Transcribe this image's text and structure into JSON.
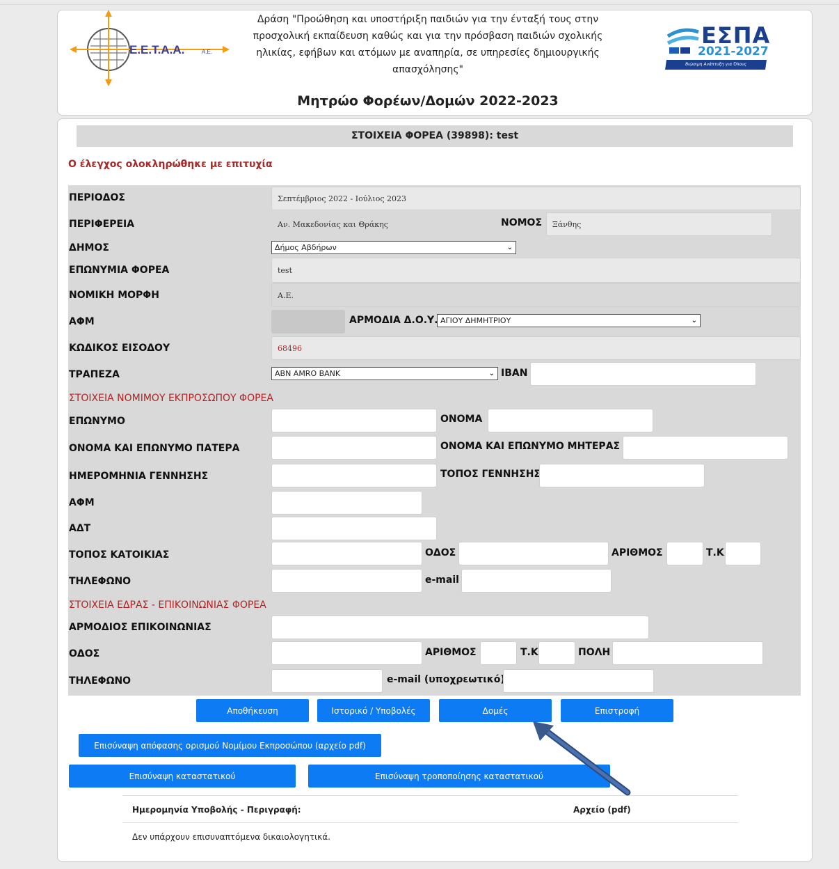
{
  "header": {
    "action_text": "Δράση \"Προώθηση και υποστήριξη παιδιών για την ένταξή τους στην προσχολική εκπαίδευση καθώς και για την πρόσβαση παιδιών σχολικής ηλικίας, εφήβων και ατόμων με αναπηρία, σε υπηρεσίες δημιουργικής απασχόλησης\"",
    "registry_title": "Μητρώο Φορέων/Δομών 2022-2023",
    "logo_left_text": "E.E.T.A.A.",
    "logo_left_suffix": "A.E.",
    "logo_right_text": "ΕΣΠΑ",
    "logo_right_years": "2021-2027",
    "logo_right_slogan": "Βιώσιμη Ανάπτυξη για Όλους"
  },
  "form": {
    "header": "ΣΤΟΙΧΕΙΑ ΦΟΡΕΑ (39898): test",
    "success_message": "Ο έλεγχος ολοκληρώθηκε με επιτυχία",
    "labels": {
      "period": "ΠΕΡΙΟΔΟΣ",
      "region": "ΠΕΡΙΦΕΡΕΙΑ",
      "prefecture": "ΝΟΜΟΣ",
      "municipality": "ΔΗΜΟΣ",
      "org_name": "ΕΠΩΝΥΜΙΑ ΦΟΡΕΑ",
      "legal_form": "ΝΟΜΙΚΗ ΜΟΡΦΗ",
      "afm": "ΑΦΜ",
      "tax_office": "ΑΡΜΟΔΙΑ Δ.Ο.Υ.",
      "login_code": "ΚΩΔΙΚΟΣ ΕΙΣΟΔΟΥ",
      "bank": "ΤΡΑΠΕΖΑ",
      "iban": "IBAN"
    },
    "values": {
      "period": "Σεπτέμβριος 2022 - Ιούλιος 2023",
      "region": "Αν. Μακεδονίας και Θράκης",
      "prefecture": "Ξάνθης",
      "municipality": "Δήμος Αβδήρων",
      "org_name": "test",
      "legal_form": "Α.Ε.",
      "tax_office": "ΑΓΙΟΥ ΔΗΜΗΤΡΙΟΥ",
      "login_code": "68496",
      "bank": "ABN AMRO BANK"
    },
    "rep_section": {
      "title": "ΣΤΟΙΧΕΙΑ ΝΟΜΙΜΟΥ ΕΚΠΡΟΣΩΠΟΥ ΦΟΡΕΑ",
      "surname": "ΕΠΩΝΥΜΟ",
      "name": "ΟΝΟΜΑ",
      "father": "ΟΝΟΜΑ ΚΑΙ ΕΠΩΝΥΜΟ ΠΑΤΕΡΑ",
      "mother": "ΟΝΟΜΑ ΚΑΙ ΕΠΩΝΥΜΟ ΜΗΤΕΡΑΣ",
      "birth_date": "ΗΜΕΡΟΜΗΝΙΑ ΓΕΝΝΗΣΗΣ",
      "birth_place": "ΤΟΠΟΣ ΓΕΝΝΗΣΗΣ",
      "afm": "ΑΦΜ",
      "adt": "ΑΔΤ",
      "residence": "ΤΟΠΟΣ ΚΑΤΟΙΚΙΑΣ",
      "street": "ΟΔΟΣ",
      "number": "ΑΡΙΘΜΟΣ",
      "tk": "Τ.Κ",
      "phone": "ΤΗΛΕΦΩΝΟ",
      "email": "e-mail"
    },
    "seat_section": {
      "title": "ΣΤΟΙΧΕΙΑ ΕΔΡΑΣ - ΕΠΙΚΟΙΝΩΝΙΑΣ ΦΟΡΕΑ",
      "contact": "ΑΡΜΟΔΙΟΣ ΕΠΙΚΟΙΝΩΝΙΑΣ",
      "street": "ΟΔΟΣ",
      "number": "ΑΡΙΘΜΟΣ",
      "tk": "Τ.Κ",
      "city": "ΠΟΛΗ",
      "phone": "ΤΗΛΕΦΩΝΟ",
      "email": "e-mail (υποχρεωτικό)"
    }
  },
  "buttons": {
    "save": "Αποθήκευση",
    "history": "Ιστορικό / Υποβολές",
    "structures": "Δομές",
    "back": "Επιστροφή",
    "attach_decision": "Επισύναψη απόφασης ορισμού Νομίμου Εκπροσώπου (αρχείο pdf)",
    "attach_statute": "Επισύναψη καταστατικού",
    "attach_statute_amend": "Επισύναψη τροποποίησης καταστατικού"
  },
  "attachments_table": {
    "headers": [
      "Ημερομηνία Υποβολής - Περιγραφή:",
      "Αρχείο (pdf)"
    ],
    "empty_message": "Δεν υπάρχουν επισυναπτόμενα δικαιολογητικά."
  },
  "colors": {
    "button_blue": "#0d7bf4",
    "section_red": "#b22222",
    "form_grey": "#d9d9d9",
    "arrow_blue": "#3a5a8c"
  },
  "icons": {
    "dropdown": "chevron-down-icon",
    "annotation": "arrow-icon"
  }
}
